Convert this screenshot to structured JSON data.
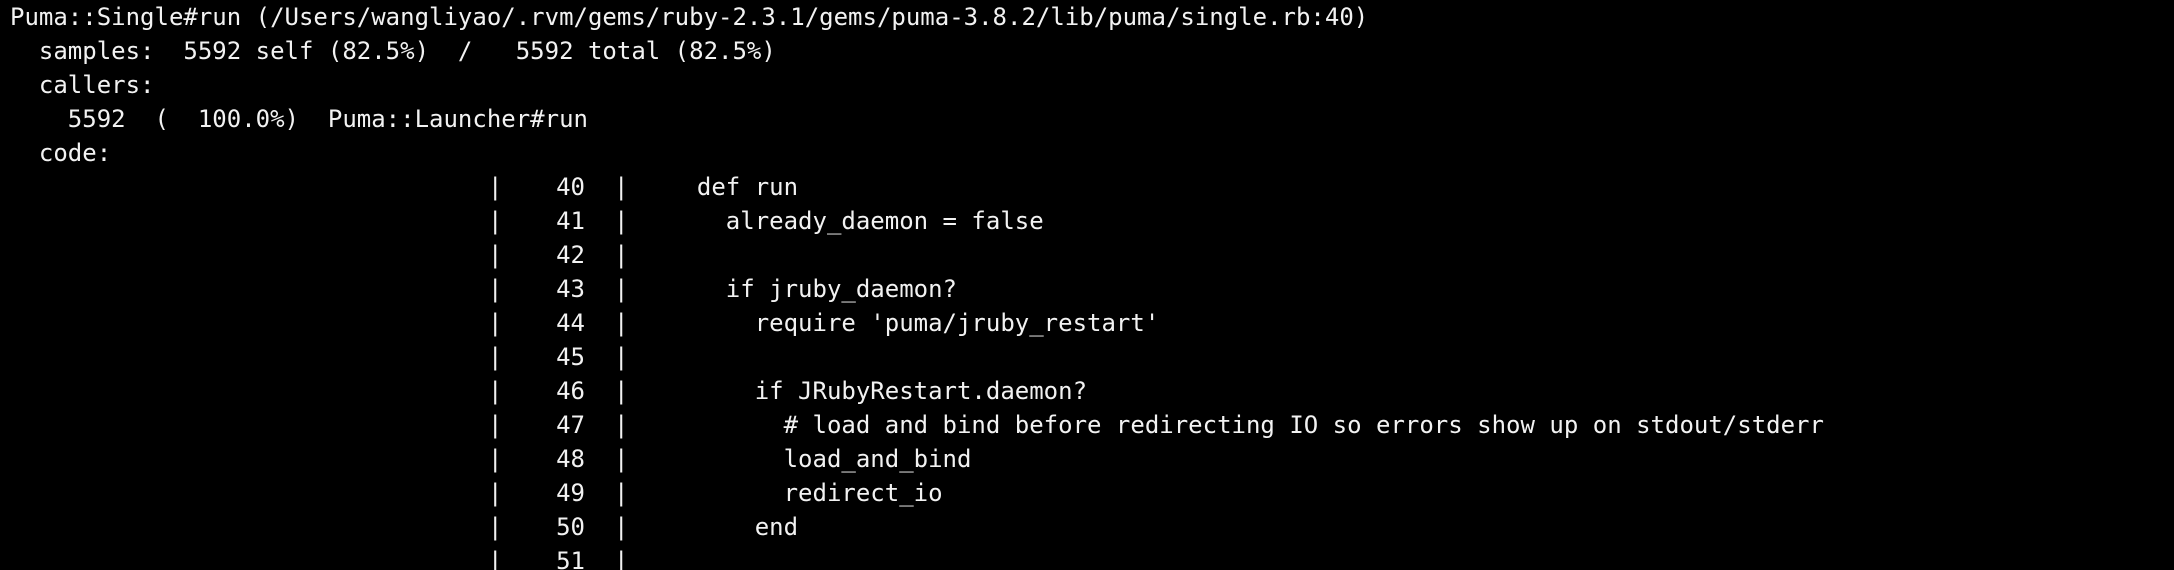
{
  "header": {
    "method_line": "Puma::Single#run (/Users/wangliyao/.rvm/gems/ruby-2.3.1/gems/puma-3.8.2/lib/puma/single.rb:40)",
    "samples_line": "  samples:  5592 self (82.5%)  /   5592 total (82.5%)",
    "callers_label": "  callers:",
    "caller_entry": "    5592  (  100.0%)  Puma::Launcher#run",
    "code_label": "  code:"
  },
  "code": {
    "separator": "|",
    "lines": [
      {
        "number": "40",
        "text": "  def run"
      },
      {
        "number": "41",
        "text": "    already_daemon = false"
      },
      {
        "number": "42",
        "text": ""
      },
      {
        "number": "43",
        "text": "    if jruby_daemon?"
      },
      {
        "number": "44",
        "text": "      require 'puma/jruby_restart'"
      },
      {
        "number": "45",
        "text": ""
      },
      {
        "number": "46",
        "text": "      if JRubyRestart.daemon?"
      },
      {
        "number": "47",
        "text": "        # load and bind before redirecting IO so errors show up on stdout/stderr"
      },
      {
        "number": "48",
        "text": "        load_and_bind"
      },
      {
        "number": "49",
        "text": "        redirect_io"
      },
      {
        "number": "50",
        "text": "      end"
      },
      {
        "number": "51",
        "text": ""
      }
    ]
  },
  "colors": {
    "background": "#000000",
    "foreground": "#f2f2f2"
  }
}
